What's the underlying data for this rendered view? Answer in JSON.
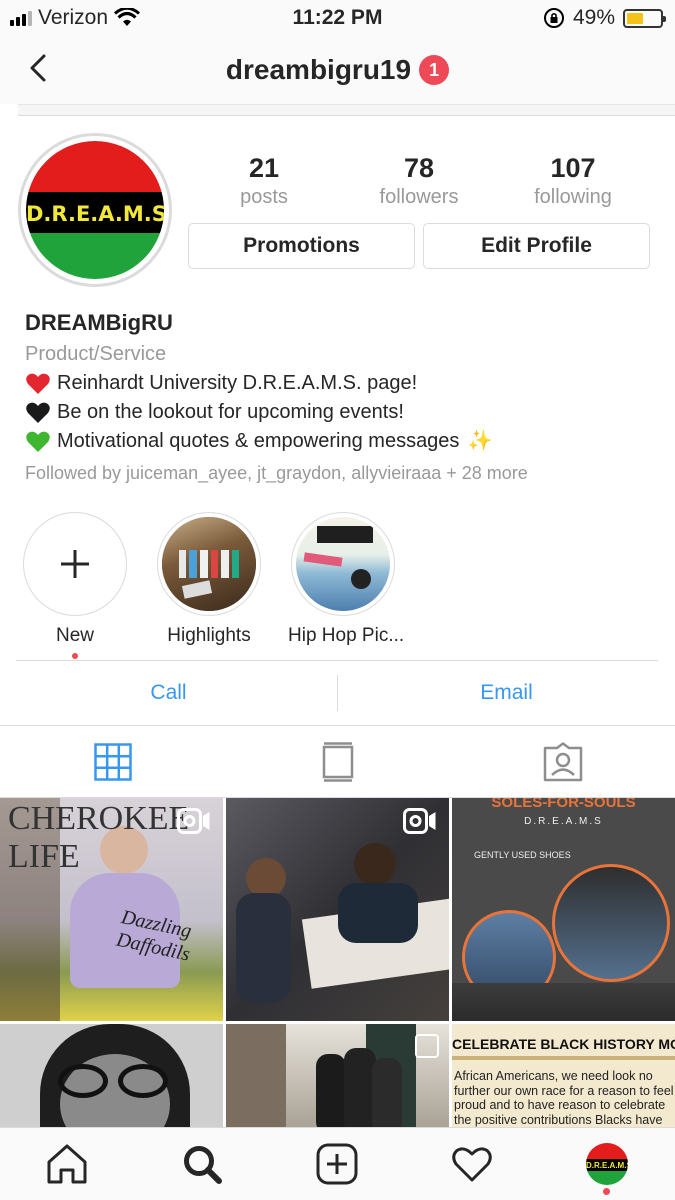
{
  "status_bar": {
    "carrier": "Verizon",
    "time": "11:22 PM",
    "battery": "49%",
    "battery_level": 0.49
  },
  "nav": {
    "title": "dreambigru19",
    "badge": "1",
    "back_icon": "chevron-left-icon"
  },
  "profile": {
    "avatar_text": "D.R.E.A.M.S",
    "stats": [
      {
        "value": "21",
        "label": "posts"
      },
      {
        "value": "78",
        "label": "followers"
      },
      {
        "value": "107",
        "label": "following"
      }
    ],
    "buttons": {
      "promotions": "Promotions",
      "edit": "Edit Profile"
    },
    "name": "DREAMBigRU",
    "category": "Product/Service",
    "bio": [
      {
        "icon": "red-heart-icon",
        "text": "Reinhardt University D.R.E.A.M.S. page!"
      },
      {
        "icon": "black-heart-icon",
        "text": "Be on the lookout for upcoming events!"
      },
      {
        "icon": "green-heart-icon",
        "text": "Motivational quotes & empowering messages"
      }
    ],
    "sparkle": "✨",
    "followed_by": "Followed by juiceman_ayee, jt_graydon, allyvieiraaa + 28 more"
  },
  "highlights": [
    {
      "label": "New"
    },
    {
      "label": "Highlights"
    },
    {
      "label": "Hip Hop Pic..."
    }
  ],
  "contact": {
    "call": "Call",
    "email": "Email"
  },
  "tabs": [
    "grid-icon",
    "feed-icon",
    "tagged-icon"
  ],
  "posts": [
    {
      "title": "CHEROKEE LIFE",
      "subtitle": "Dazzling Daffodils",
      "has_video": true
    },
    {
      "title": "",
      "subtitle": "",
      "has_video": true
    },
    {
      "title": "SOLES-FOR-SOULS",
      "subtitle": "D.R.E.A.M.S",
      "caption": "GENTLY USED SHOES",
      "has_video": false
    },
    {
      "title": "",
      "subtitle": "",
      "has_video": false
    },
    {
      "title": "",
      "subtitle": "",
      "has_video": false
    },
    {
      "title": "CELEBRATE BLACK HISTORY MONTH",
      "body": "African Americans, we need look no further our own race for a reason to feel proud and to have reason to celebrate the positive contributions Blacks have made in the world. I have attempted to capture some of the contributions Blacks have made",
      "has_video": false
    }
  ],
  "colors": {
    "accent": "#3897f0",
    "badge": "#ed4956",
    "border": "#dbdbdb",
    "muted": "#999999"
  },
  "tab_bar": [
    "home-icon",
    "search-icon",
    "add-post-icon",
    "activity-heart-icon",
    "profile-avatar-icon"
  ]
}
